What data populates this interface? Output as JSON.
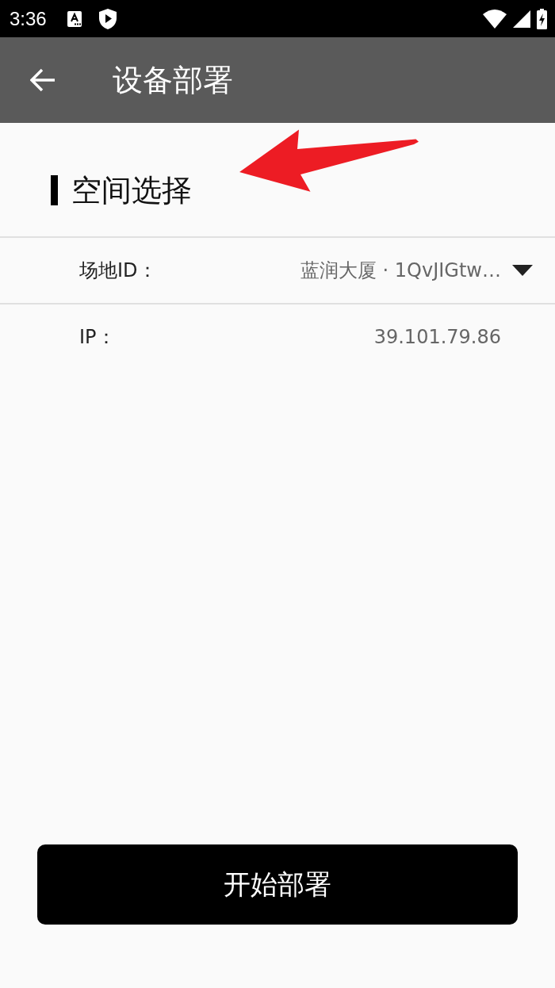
{
  "status_bar": {
    "time": "3:36"
  },
  "app_bar": {
    "title": "设备部署"
  },
  "section": {
    "title": "空间选择"
  },
  "fields": [
    {
      "kind": "dropdown",
      "label": "场地ID：",
      "value": "蓝润大厦 · 1QvJIGtw…"
    },
    {
      "kind": "text",
      "label": "IP：",
      "value": "39.101.79.86"
    }
  ],
  "primary_button": {
    "label": "开始部署"
  },
  "annotations": [
    {
      "kind": "arrow",
      "color": "#ed1c24"
    }
  ]
}
